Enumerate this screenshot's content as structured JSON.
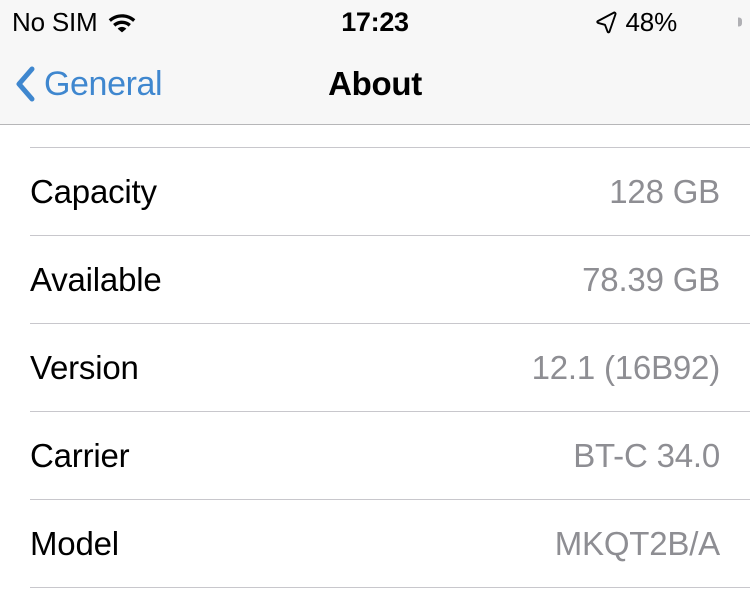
{
  "status_bar": {
    "carrier": "No SIM",
    "wifi_icon": "wifi-icon",
    "time": "17:23",
    "location_icon": "location-arrow-icon",
    "battery_percent": "48%",
    "battery_level": 48
  },
  "nav_bar": {
    "back_icon": "chevron-left-icon",
    "back_label": "General",
    "title": "About"
  },
  "list": {
    "rows": [
      {
        "label": "Capacity",
        "value": "128 GB"
      },
      {
        "label": "Available",
        "value": "78.39 GB"
      },
      {
        "label": "Version",
        "value": "12.1 (16B92)"
      },
      {
        "label": "Carrier",
        "value": "BT-C 34.0"
      },
      {
        "label": "Model",
        "value": "MKQT2B/A"
      }
    ]
  },
  "colors": {
    "accent_blue": "#3f87cf",
    "value_gray": "#8e8e93",
    "separator": "#c8c7cc",
    "bar_background": "#f7f7f7",
    "content_background": "#ffffff",
    "label_black": "#000000"
  }
}
